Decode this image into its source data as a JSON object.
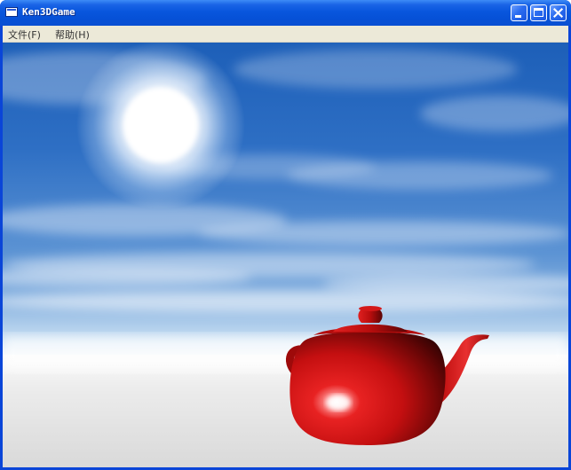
{
  "window": {
    "title": "Ken3DGame",
    "icon": "app-window-icon",
    "buttons": {
      "minimize": "minimize-icon",
      "maximize": "maximize-icon",
      "close": "close-icon"
    }
  },
  "menubar": {
    "items": [
      {
        "label": "文件(F)"
      },
      {
        "label": "帮助(H)"
      }
    ]
  },
  "scene": {
    "elements": [
      "sky",
      "sun",
      "clouds",
      "ground",
      "teapot"
    ],
    "teapot_color": "#c40f10",
    "sky_color": "#2e6fc4",
    "ground_color": "#dcdcdc"
  },
  "colors": {
    "titlebar": "#0856dd",
    "menubar": "#ece9d8",
    "frame": "#0a45d8"
  }
}
